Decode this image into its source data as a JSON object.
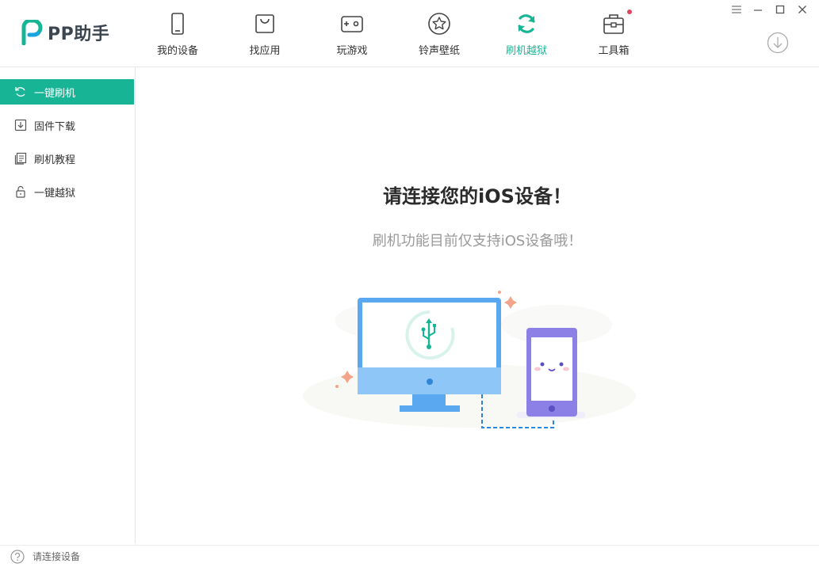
{
  "app": {
    "logo_text": "PP助手"
  },
  "nav": {
    "items": [
      {
        "label": "我的设备",
        "icon": "phone-icon"
      },
      {
        "label": "找应用",
        "icon": "shopping-bag-icon"
      },
      {
        "label": "玩游戏",
        "icon": "gamepad-icon"
      },
      {
        "label": "铃声壁纸",
        "icon": "star-icon"
      },
      {
        "label": "刷机越狱",
        "icon": "refresh-icon",
        "active": true
      },
      {
        "label": "工具箱",
        "icon": "toolbox-icon",
        "badge": "red-dot"
      }
    ]
  },
  "window_controls": [
    "menu-icon",
    "minimize-icon",
    "maximize-icon",
    "close-icon"
  ],
  "sidebar": {
    "items": [
      {
        "label": "一键刷机",
        "icon": "refresh-icon",
        "active": true
      },
      {
        "label": "固件下载",
        "icon": "download-box-icon"
      },
      {
        "label": "刷机教程",
        "icon": "document-icon"
      },
      {
        "label": "一键越狱",
        "icon": "unlock-icon"
      }
    ]
  },
  "main": {
    "title": "请连接您的iOS设备！",
    "subtitle": "刷机功能目前仅支持iOS设备哦！"
  },
  "status": {
    "text": "请连接设备"
  },
  "colors": {
    "accent": "#17b596",
    "monitor": "#5aa9f0",
    "phone": "#8c7fe6",
    "badge": "#e0435e"
  }
}
